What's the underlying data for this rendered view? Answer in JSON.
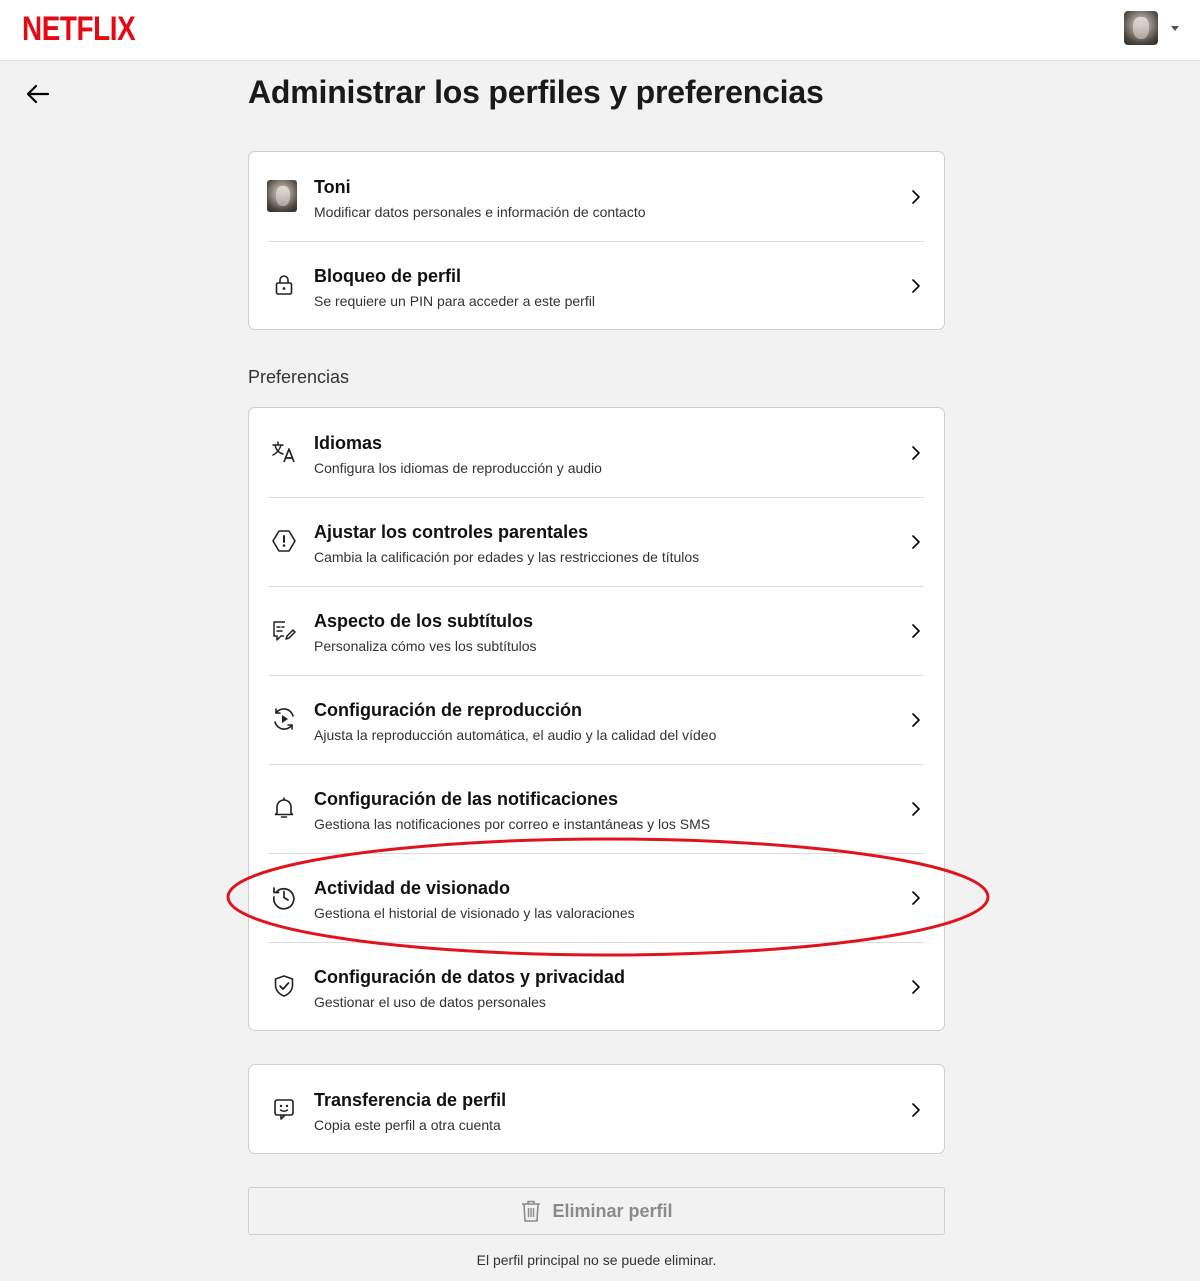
{
  "header": {
    "logo_text": "NETFLIX",
    "brand_color": "#e50914"
  },
  "page": {
    "title": "Administrar los perfiles y preferencias"
  },
  "profile_card": {
    "items": [
      {
        "title": "Toni",
        "subtitle": "Modificar datos personales e información de contacto",
        "icon": "profile-avatar"
      },
      {
        "title": "Bloqueo de perfil",
        "subtitle": "Se requiere un PIN para acceder a este perfil",
        "icon": "lock-icon"
      }
    ]
  },
  "preferences": {
    "label": "Preferencias",
    "items": [
      {
        "title": "Idiomas",
        "subtitle": "Configura los idiomas de reproducción y audio",
        "icon": "translate-icon"
      },
      {
        "title": "Ajustar los controles parentales",
        "subtitle": "Cambia la calificación por edades y las restricciones de títulos",
        "icon": "warning-hexagon-icon"
      },
      {
        "title": "Aspecto de los subtítulos",
        "subtitle": "Personaliza cómo ves los subtítulos",
        "icon": "subtitles-edit-icon"
      },
      {
        "title": "Configuración de reproducción",
        "subtitle": "Ajusta la reproducción automática, el audio y la calidad del vídeo",
        "icon": "playback-icon"
      },
      {
        "title": "Configuración de las notificaciones",
        "subtitle": "Gestiona las notificaciones por correo e instantáneas y los SMS",
        "icon": "bell-icon"
      },
      {
        "title": "Actividad de visionado",
        "subtitle": "Gestiona el historial de visionado y las valoraciones",
        "icon": "history-icon"
      },
      {
        "title": "Configuración de datos y privacidad",
        "subtitle": "Gestionar el uso de datos personales",
        "icon": "shield-check-icon"
      }
    ]
  },
  "transfer_card": {
    "items": [
      {
        "title": "Transferencia de perfil",
        "subtitle": "Copia este perfil a otra cuenta",
        "icon": "profile-transfer-icon"
      }
    ]
  },
  "delete": {
    "label": "Eliminar perfil",
    "note": "El perfil principal no se puede eliminar."
  },
  "annotation": {
    "color": "#e0141e",
    "highlighted_item": "Actividad de visionado"
  }
}
